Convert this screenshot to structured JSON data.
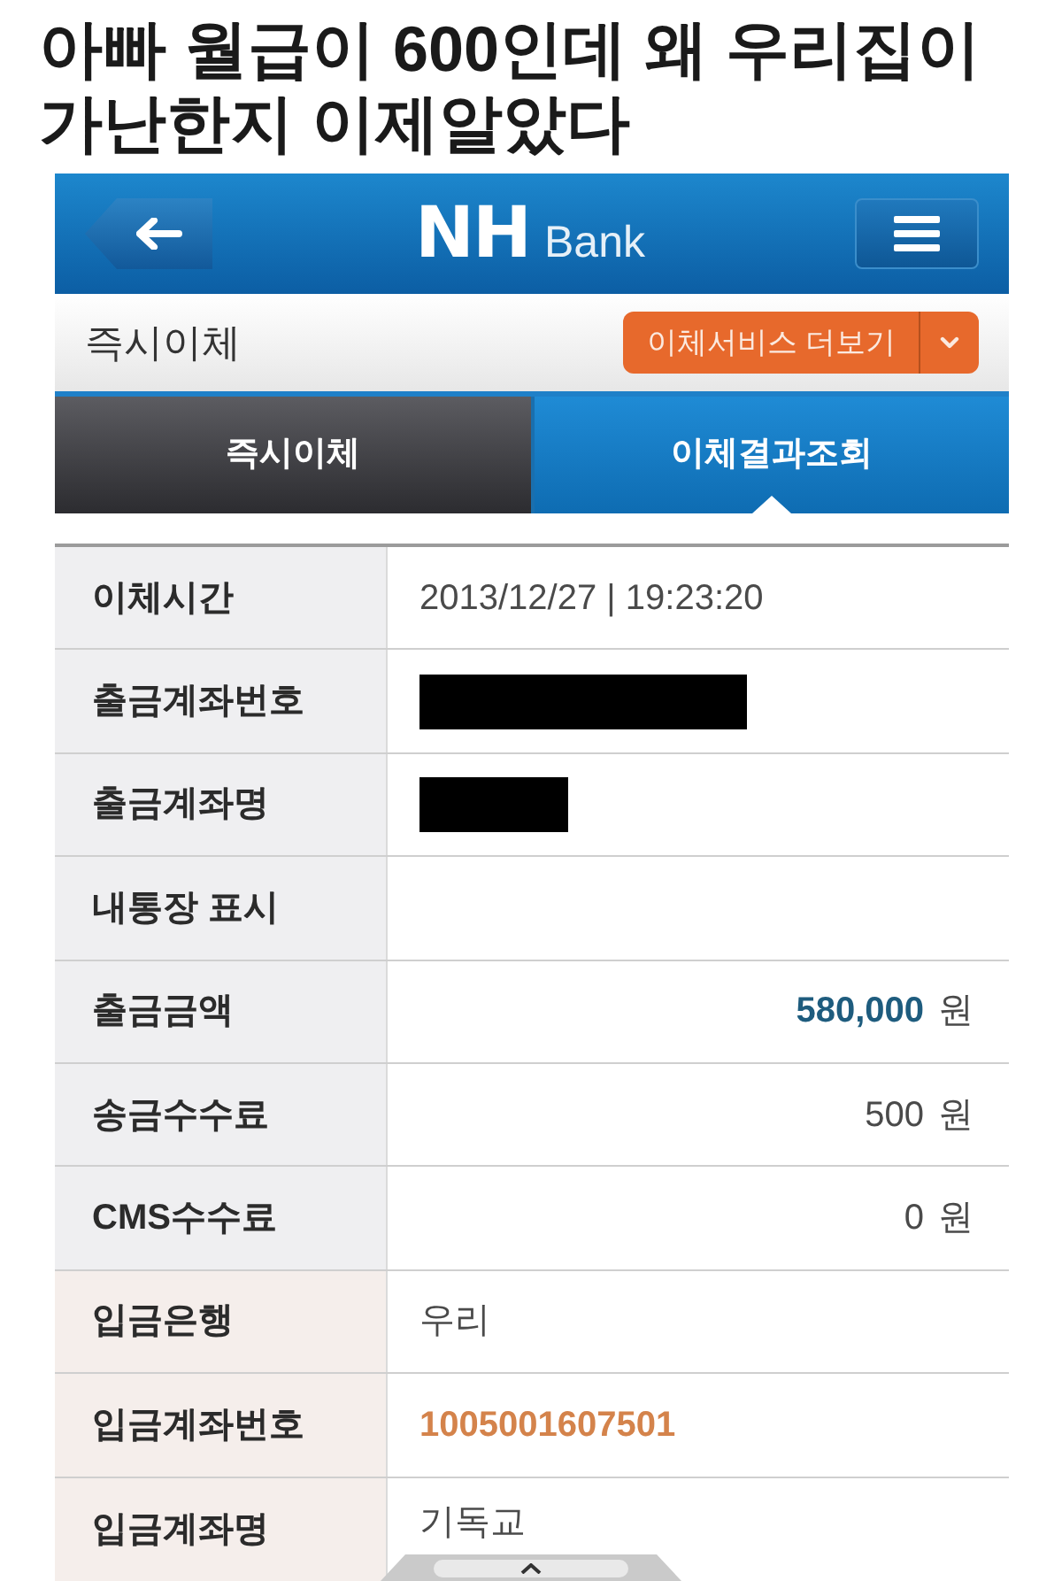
{
  "title": "아빠 월급이 600인데 왜 우리집이 가난한지 이제알았다",
  "app_header": {
    "logo": {
      "mark": "NH",
      "text": "Bank"
    }
  },
  "page_bar": {
    "title": "즉시이체",
    "services_button": "이체서비스 더보기"
  },
  "tabs": [
    {
      "label": "즉시이체",
      "selected": false
    },
    {
      "label": "이체결과조회",
      "selected": true
    }
  ],
  "details": {
    "rows": [
      {
        "label": "이체시간",
        "kind": "text",
        "value": "2013/12/27 | 19:23:20",
        "color": "#efeff1"
      },
      {
        "label": "출금계좌번호",
        "kind": "redacted",
        "wide": true,
        "color": "#efeff1"
      },
      {
        "label": "출금계좌명",
        "kind": "redacted",
        "wide": false,
        "color": "#efeff1"
      },
      {
        "label": "내통장 표시",
        "kind": "text",
        "color": "#efeff1"
      },
      {
        "label": "출금금액",
        "kind": "amount",
        "value": "580,000",
        "unit": "원",
        "highlight": true,
        "color": "#efeff1"
      },
      {
        "label": "송금수수료",
        "kind": "amount",
        "value": "500",
        "unit": "원",
        "highlight": false,
        "color": "#efeff1"
      },
      {
        "label": "CMS수수료",
        "kind": "amount",
        "value": "0",
        "unit": "원",
        "highlight": false,
        "color": "#efeff1"
      },
      {
        "label": "입금은행",
        "kind": "text",
        "value": "우리",
        "color": "#f5eeeb"
      },
      {
        "label": "입금계좌번호",
        "kind": "account",
        "value": "1005001607501",
        "color": "#f5eeeb"
      },
      {
        "label": "입금계좌명",
        "kind": "text",
        "value": "기독교",
        "color": "#f5eeeb"
      }
    ]
  }
}
